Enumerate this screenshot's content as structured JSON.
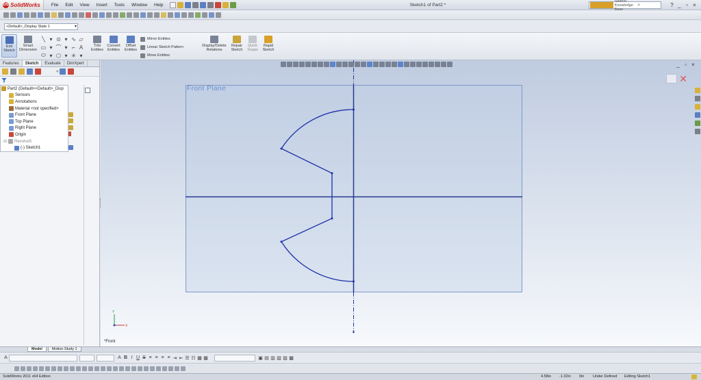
{
  "app": {
    "logo_text": "SolidWorks",
    "document_title": "Sketch1 of Part2 *"
  },
  "menu": {
    "items": [
      "File",
      "Edit",
      "View",
      "Insert",
      "Tools",
      "Window",
      "Help"
    ]
  },
  "search": {
    "placeholder": "Search Knowledge Base"
  },
  "window_controls": {
    "help": "?",
    "minimize": "_",
    "restore": "▫",
    "close": "×"
  },
  "config": {
    "selected": "<Default>_Display State 1"
  },
  "command_manager": {
    "exit_sketch": "Exit Sketch",
    "smart_dimension": "Smart Dimension",
    "trim_entities": "Trim Entities",
    "convert_entities": "Convert Entities",
    "offset_entities": "Offset Entities",
    "mirror_entities": "Mirror Entities",
    "linear_sketch_pattern": "Linear Sketch Pattern",
    "move_entities": "Move Entities",
    "display_delete_relations": "Display/Delete Relations",
    "repair_sketch": "Repair Sketch",
    "quick_snaps": "Quick Snaps",
    "rapid_sketch": "Rapid Sketch"
  },
  "panel_tabs": [
    {
      "label": "Features",
      "active": false
    },
    {
      "label": "Sketch",
      "active": true
    },
    {
      "label": "Evaluate",
      "active": false
    },
    {
      "label": "DimXpert",
      "active": false
    }
  ],
  "feature_tree": [
    {
      "label": "Part2  (Default<<Default>_Disp",
      "indent": 0,
      "color": "#c89a2a",
      "muted": false
    },
    {
      "label": "Sensors",
      "indent": 1,
      "color": "#d8b13b",
      "muted": false
    },
    {
      "label": "Annotations",
      "indent": 1,
      "color": "#d8b13b",
      "muted": false
    },
    {
      "label": "Material <not specified>",
      "indent": 1,
      "color": "#9c6b3a",
      "muted": false
    },
    {
      "label": "Front Plane",
      "indent": 1,
      "color": "#7a9bd4",
      "muted": false
    },
    {
      "label": "Top Plane",
      "indent": 1,
      "color": "#7a9bd4",
      "muted": false
    },
    {
      "label": "Right Plane",
      "indent": 1,
      "color": "#7a9bd4",
      "muted": false
    },
    {
      "label": "Origin",
      "indent": 1,
      "color": "#c84a3a",
      "muted": false
    },
    {
      "label": "Revolve5",
      "indent": 1,
      "color": "#a8a8a8",
      "muted": true
    },
    {
      "label": "(-) Sketch1",
      "indent": 2,
      "color": "#5a7ec8",
      "muted": false
    }
  ],
  "viewport": {
    "plane_label": "Front Plane",
    "view_label": "*Front"
  },
  "bottom_tabs": [
    {
      "label": "Model",
      "active": true
    },
    {
      "label": "Motion Study 1",
      "active": false
    }
  ],
  "status_bar": {
    "edition": "SolidWorks 2011 x64 Edition",
    "x": "4.58in",
    "y": "-1.32in",
    "z": "0in",
    "state": "Under Defined",
    "mode": "Editing Sketch1"
  },
  "colors": {
    "sketch_line": "#1b2fa8",
    "plane_border": "#7e97c9",
    "axis_line": "#27388f"
  }
}
